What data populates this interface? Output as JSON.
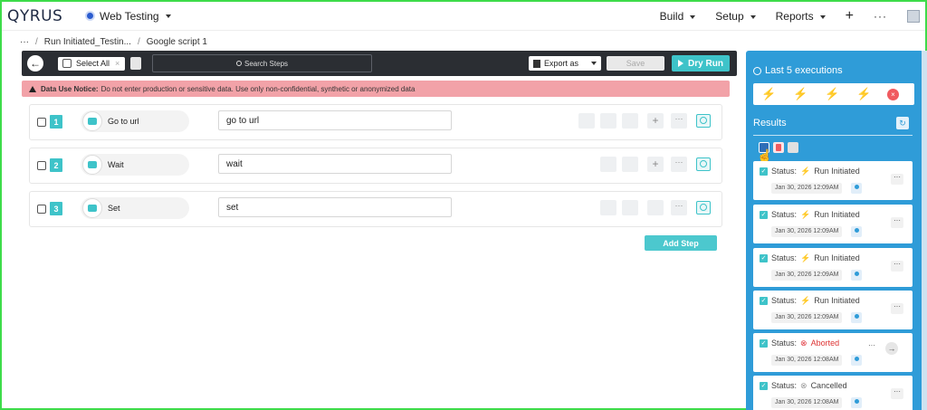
{
  "brand": {
    "logo": "QYRUS"
  },
  "nav": {
    "project": "Web Testing",
    "menu": [
      {
        "label": "Build"
      },
      {
        "label": "Setup"
      },
      {
        "label": "Reports"
      }
    ],
    "plus": "+",
    "more": "···"
  },
  "breadcrumb": {
    "root": "···",
    "items": [
      "Run Initiated_Testin...",
      "Google script 1"
    ]
  },
  "toolbar": {
    "select_all": "Select All",
    "search_placeholder": "Search Steps",
    "export": "Export as",
    "save": "Save",
    "dry_run": "Dry Run"
  },
  "notice": {
    "bold": "Data Use Notice:",
    "text": "Do not enter production or sensitive data. Use only non-confidential, synthetic or anonymized data"
  },
  "steps": [
    {
      "number": "1",
      "action": "Go to url",
      "description": "go to url"
    },
    {
      "number": "2",
      "action": "Wait",
      "description": "wait"
    },
    {
      "number": "3",
      "action": "Set",
      "description": "set"
    }
  ],
  "add_step": "Add Step",
  "panel": {
    "title": "Last 5 executions",
    "results_title": "Results",
    "results": [
      {
        "status_label": "Status:",
        "status": "Run Initiated",
        "date": "Jan 30, 2026 12:09AM"
      },
      {
        "status_label": "Status:",
        "status": "Run Initiated",
        "date": "Jan 30, 2026 12:09AM"
      },
      {
        "status_label": "Status:",
        "status": "Run Initiated",
        "date": "Jan 30, 2026 12:09AM"
      },
      {
        "status_label": "Status:",
        "status": "Run Initiated",
        "date": "Jan 30, 2026 12:09AM"
      },
      {
        "status_label": "Status:",
        "status": "Aborted",
        "date": "Jan 30, 2026 12:08AM"
      },
      {
        "status_label": "Status:",
        "status": "Cancelled",
        "date": "Jan 30, 2026 12:08AM"
      }
    ]
  },
  "colors": {
    "accent": "#3ec3c9",
    "panel": "#2f9cd8",
    "notice": "#f2a2a8",
    "toolbar": "#2b2e33"
  }
}
